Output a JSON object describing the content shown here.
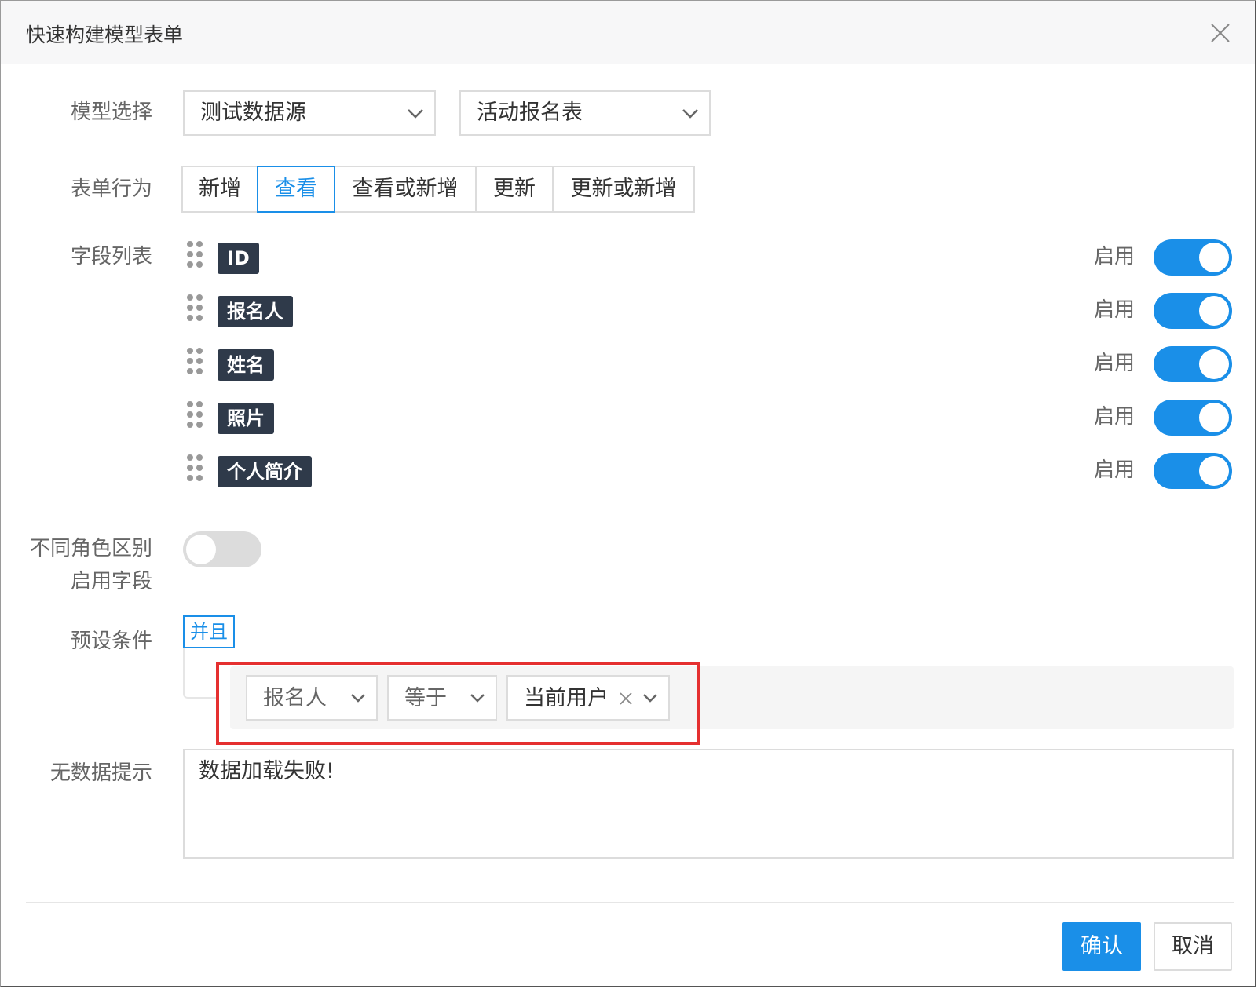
{
  "dialog": {
    "title": "快速构建模型表单",
    "close_icon": "close-icon"
  },
  "form": {
    "model_select_label": "模型选择",
    "datasource_value": "测试数据源",
    "table_value": "活动报名表",
    "behavior_label": "表单行为",
    "behavior_options": [
      "新增",
      "查看",
      "查看或新增",
      "更新",
      "更新或新增"
    ],
    "behavior_selected": "查看",
    "fields_label": "字段列表",
    "fields": [
      {
        "name": "ID",
        "status_label": "启用",
        "enabled": true
      },
      {
        "name": "报名人",
        "status_label": "启用",
        "enabled": true
      },
      {
        "name": "姓名",
        "status_label": "启用",
        "enabled": true
      },
      {
        "name": "照片",
        "status_label": "启用",
        "enabled": true
      },
      {
        "name": "个人简介",
        "status_label": "启用",
        "enabled": true
      }
    ],
    "role_label_line1": "不同角色区别",
    "role_label_line2": "启用字段",
    "role_toggle_on": false,
    "preset_label": "预设条件",
    "preset_logic": "并且",
    "condition": {
      "field": "报名人",
      "operator": "等于",
      "value": "当前用户"
    },
    "empty_hint_label": "无数据提示",
    "empty_hint_value": "数据加载失败!"
  },
  "footer": {
    "confirm_label": "确认",
    "cancel_label": "取消"
  },
  "colors": {
    "accent": "#1a8fe8",
    "tag_bg": "#2f3a4a",
    "highlight": "#e53030"
  }
}
